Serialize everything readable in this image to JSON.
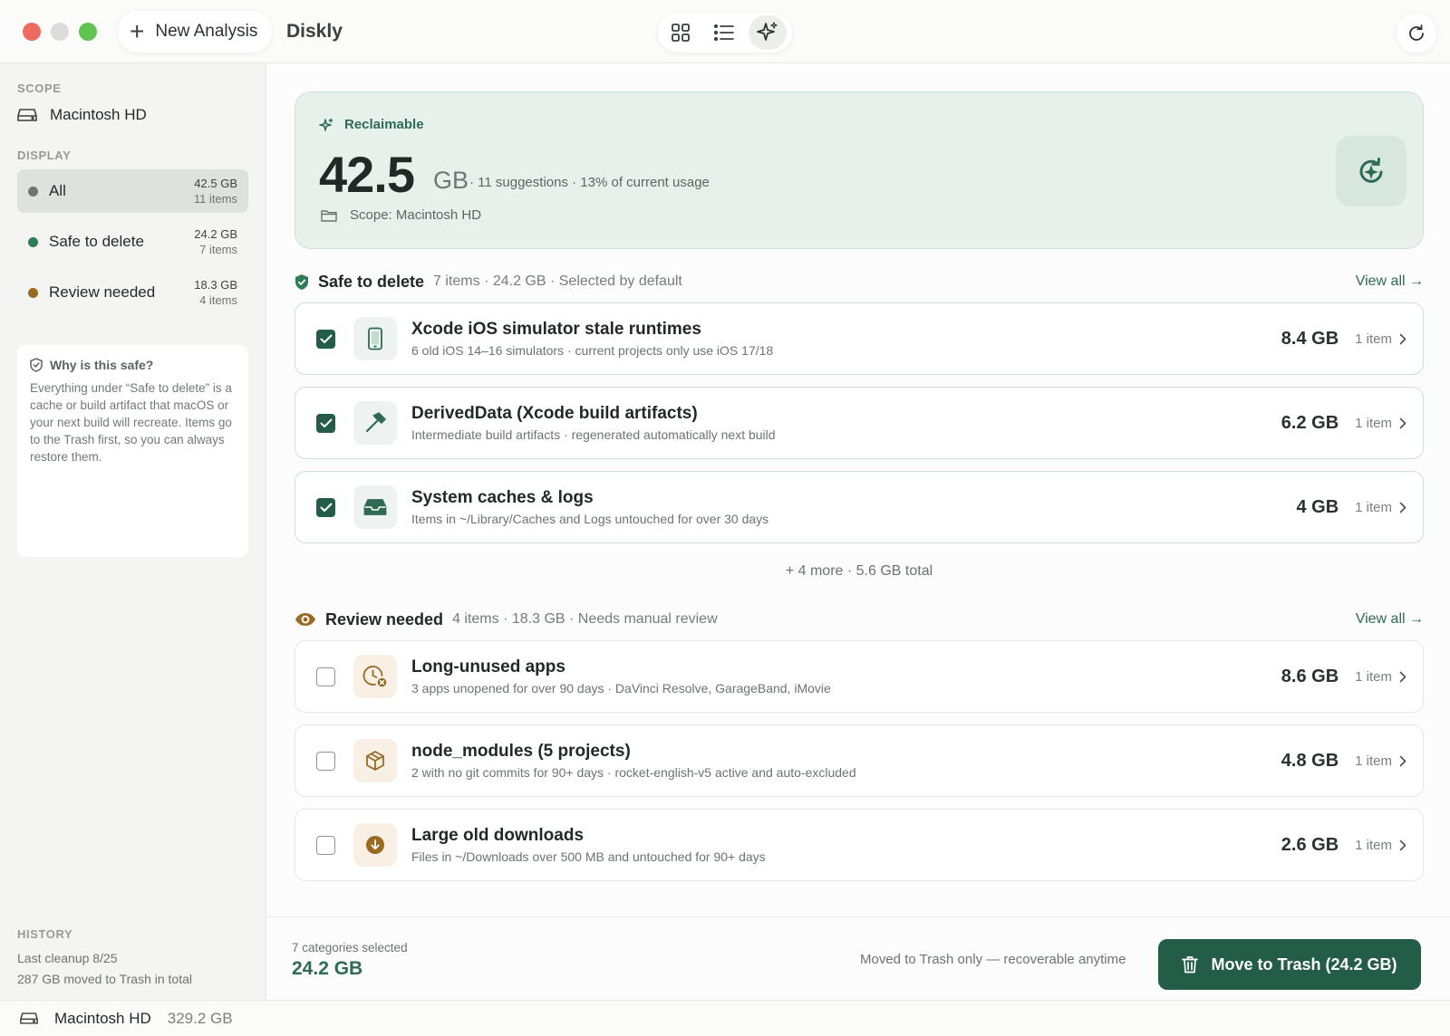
{
  "toolbar": {
    "new_analysis_label": "New Analysis",
    "app_title": "Diskly",
    "views": [
      {
        "icon": "grid-icon",
        "active": false
      },
      {
        "icon": "list-icon",
        "active": false
      },
      {
        "icon": "sparkle-icon",
        "active": true
      }
    ]
  },
  "sidebar": {
    "scope_heading": "SCOPE",
    "scope_value": "Macintosh HD",
    "display_heading": "DISPLAY",
    "filters": [
      {
        "label": "All",
        "size": "42.5 GB",
        "count": "11 items",
        "dot_color": "#6f7572",
        "active": true
      },
      {
        "label": "Safe to delete",
        "size": "24.2 GB",
        "count": "7 items",
        "dot_color": "#2e7d55",
        "active": false
      },
      {
        "label": "Review needed",
        "size": "18.3 GB",
        "count": "4 items",
        "dot_color": "#9a6a22",
        "active": false
      }
    ],
    "info": {
      "title": "Why is this safe?",
      "body": "Everything under “Safe to delete” is a cache or build artifact that macOS or your next build will recreate. Items go to the Trash first, so you can always restore them."
    },
    "history": {
      "heading": "HISTORY",
      "last_cleanup": "Last cleanup 8/25",
      "total_moved": "287 GB moved to Trash in total"
    }
  },
  "hero": {
    "label": "Reclaimable",
    "value": "42.5",
    "unit": "GB",
    "meta": "· 11 suggestions · 13% of current usage",
    "scope": "Scope: Macintosh HD"
  },
  "safe_section": {
    "title": "Safe to delete",
    "meta": "7 items · 24.2 GB · Selected by default",
    "view_all": "View all →",
    "items": [
      {
        "title": "Xcode iOS simulator stale runtimes",
        "subtitle": "6 old iOS 14–16 simulators · current projects only use iOS 17/18",
        "size": "8.4 GB",
        "count": "1 item",
        "checked": true,
        "icon": "phone-icon"
      },
      {
        "title": "DerivedData (Xcode build artifacts)",
        "subtitle": "Intermediate build artifacts · regenerated automatically next build",
        "size": "6.2 GB",
        "count": "1 item",
        "checked": true,
        "icon": "hammer-icon"
      },
      {
        "title": "System caches & logs",
        "subtitle": "Items in ~/Library/Caches and Logs untouched for over 30 days",
        "size": "4 GB",
        "count": "1 item",
        "checked": true,
        "icon": "tray-icon"
      }
    ],
    "more": "+ 4 more · 5.6 GB total"
  },
  "review_section": {
    "title": "Review needed",
    "meta": "4 items · 18.3 GB · Needs manual review",
    "view_all": "View all →",
    "items": [
      {
        "title": "Long-unused apps",
        "subtitle": "3 apps unopened for over 90 days · DaVinci Resolve, GarageBand, iMovie",
        "size": "8.6 GB",
        "count": "1 item",
        "checked": false,
        "icon": "clock-x-icon"
      },
      {
        "title": "node_modules (5 projects)",
        "subtitle": "2 with no git commits for 90+ days · rocket-english-v5 active and auto-excluded",
        "size": "4.8 GB",
        "count": "1 item",
        "checked": false,
        "icon": "package-icon"
      },
      {
        "title": "Large old downloads",
        "subtitle": "Files in ~/Downloads over 500 MB and untouched for 90+ days",
        "size": "2.6 GB",
        "count": "1 item",
        "checked": false,
        "icon": "download-icon"
      }
    ]
  },
  "footer": {
    "selected": "7 categories selected",
    "total": "24.2 GB",
    "note": "Moved to Trash only — recoverable anytime",
    "action_label": "Move to Trash (24.2 GB)"
  },
  "statusbar": {
    "disk": "Macintosh HD",
    "size": "329.2 GB"
  },
  "colors": {
    "accent": "#235c47",
    "accent_text": "#2e6b52",
    "hero_bg": "#e7f1ec",
    "review": "#9a6a22"
  }
}
